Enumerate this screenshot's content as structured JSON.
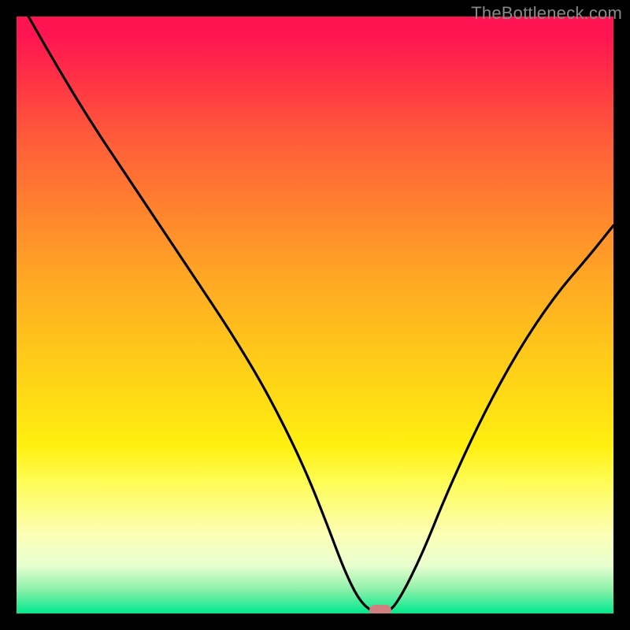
{
  "watermark": "TheBottleneck.com",
  "chart_data": {
    "type": "line",
    "title": "",
    "xlabel": "",
    "ylabel": "",
    "x_range": [
      0,
      100
    ],
    "y_range": [
      0,
      100
    ],
    "series": [
      {
        "name": "bottleneck-curve",
        "x": [
          2,
          6,
          12,
          18,
          24,
          30,
          36,
          42,
          48,
          52,
          55,
          57.5,
          60,
          62,
          64,
          68,
          72,
          78,
          84,
          90,
          96,
          100
        ],
        "y": [
          100,
          93,
          83,
          74,
          65,
          56,
          47,
          37,
          25,
          15,
          7,
          2,
          0,
          0,
          2,
          10,
          20,
          33,
          44,
          53,
          60,
          65
        ]
      }
    ],
    "marker": {
      "x": 61,
      "y": 0.5,
      "label": "optimal-point"
    },
    "background_gradient": {
      "top": "#ff1452",
      "mid": "#ffe014",
      "bottom": "#00e88e"
    }
  }
}
